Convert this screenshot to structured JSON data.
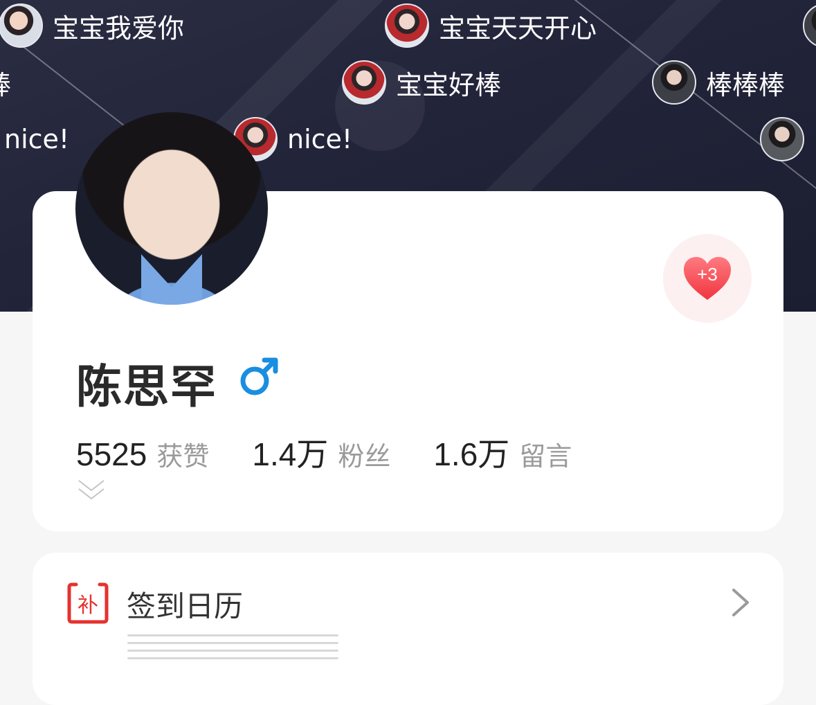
{
  "banner": {
    "danmu": [
      {
        "text": "宝宝我爱你",
        "avatar": "avatar-a"
      },
      {
        "text": "宝宝天天开心",
        "avatar": "avatar-b"
      },
      {
        "text": "棒",
        "avatar": "none"
      },
      {
        "text": "宝宝好棒",
        "avatar": "avatar-b"
      },
      {
        "text": "棒棒棒",
        "avatar": "avatar-c"
      },
      {
        "text": "nice!",
        "avatar": "none"
      },
      {
        "text": "nice!",
        "avatar": "avatar-b"
      }
    ]
  },
  "profile": {
    "name": "陈思罕",
    "gender_icon": "male-symbol-icon",
    "gender_color": "#1a8ee0",
    "like_badge": "+3",
    "stats": [
      {
        "value": "5525",
        "label": "获赞"
      },
      {
        "value": "1.4万",
        "label": "粉丝"
      },
      {
        "value": "1.6万",
        "label": "留言"
      }
    ]
  },
  "calendar": {
    "icon_text": "补",
    "title": "签到日历",
    "accent": "#e5322d"
  }
}
